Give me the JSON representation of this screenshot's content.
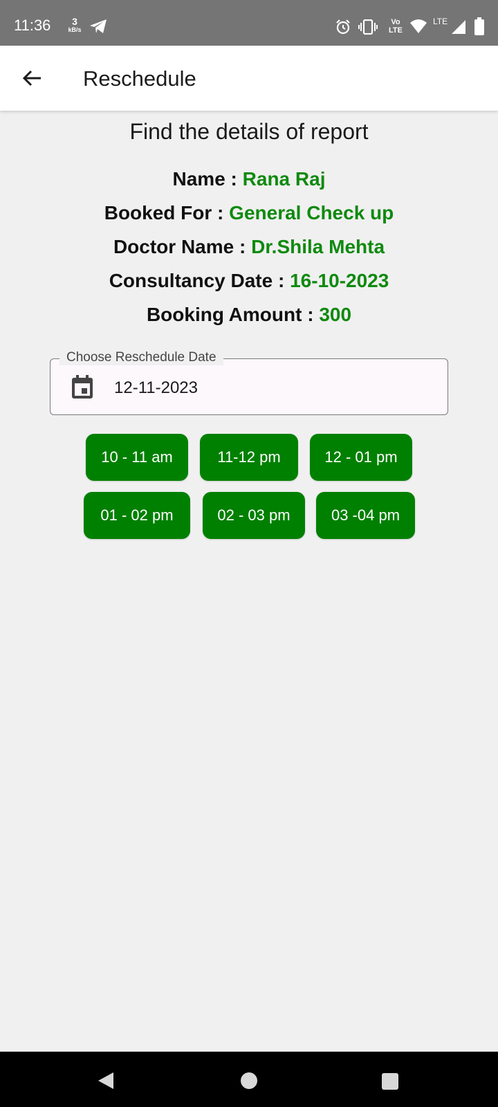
{
  "status_bar": {
    "time": "11:36",
    "speed_value": "3",
    "speed_unit": "kB/s",
    "icons": [
      "telegram-icon",
      "alarm-icon",
      "vibrate-icon",
      "volte-icon",
      "wifi-icon",
      "lte-signal-icon",
      "battery-icon"
    ],
    "volte_label_1": "Vo",
    "volte_label_2": "LTE",
    "lte_label": "LTE"
  },
  "app_bar": {
    "title": "Reschedule",
    "back_icon": "arrow-left-icon"
  },
  "report": {
    "heading": "Find the details of report",
    "details": [
      {
        "label": "Name : ",
        "value": "Rana Raj"
      },
      {
        "label": "Booked For : ",
        "value": "General Check up"
      },
      {
        "label": "Doctor Name : ",
        "value": "Dr.Shila Mehta"
      },
      {
        "label": "Consultancy Date : ",
        "value": "16-10-2023"
      },
      {
        "label": "Booking Amount : ",
        "value": "300"
      }
    ]
  },
  "reschedule": {
    "field_label": "Choose Reschedule Date",
    "date_value": "12-11-2023",
    "icon": "calendar-icon"
  },
  "time_slots": [
    "10 - 11 am",
    "11-12 pm",
    "12 - 01 pm",
    "01 - 02 pm",
    "02 - 03 pm",
    "03 -04 pm"
  ],
  "colors": {
    "accent_green": "#008000",
    "value_green": "#0f8a0f",
    "background": "#f0f0f0",
    "status_bar": "#757575"
  },
  "nav_bar": {
    "icons": [
      "back-triangle-icon",
      "home-circle-icon",
      "recents-square-icon"
    ]
  }
}
